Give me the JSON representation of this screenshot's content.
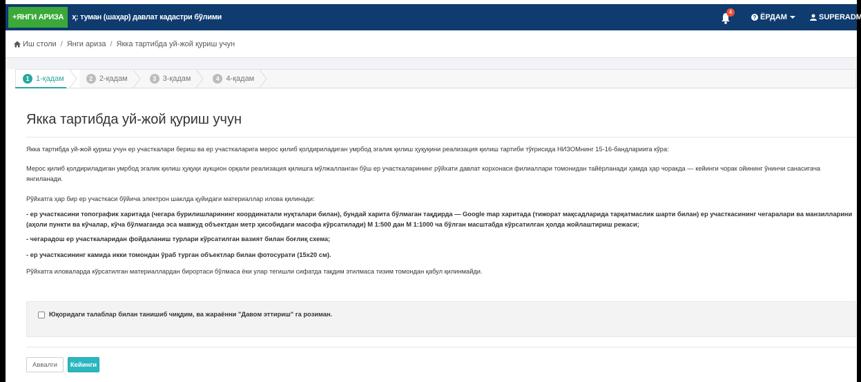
{
  "topbar": {
    "new_application_label": "+ЯНГИ АРИЗА",
    "org_title": "ҳ: туман (шаҳар) давлат кадастри бўлими",
    "notification_count": "4",
    "help_label": "ЁРДАМ",
    "user_label": "SUPERADMIN"
  },
  "breadcrumb": {
    "items": [
      "Иш столи",
      "Янги ариза",
      "Якка тартибда уй-жой қуриш учун"
    ]
  },
  "steps": [
    {
      "num": "1",
      "label": "1-қадам"
    },
    {
      "num": "2",
      "label": "2-қадам"
    },
    {
      "num": "3",
      "label": "3-қадам"
    },
    {
      "num": "4",
      "label": "4-қадам"
    }
  ],
  "page_title": "Якка тартибда уй-жой қуриш учун",
  "paragraphs": {
    "p1": "Якка тартибда уй-жой қуриш учун ер участкалари бериш ва ер участкаларига мерос қилиб қолдириладиган умрбод эгалик қилиш ҳуқуқини реализация қилиш тартиби тўғрисида НИЗОМнинг 15-16-бандлариига кўра:",
    "p2": "Мерос қилиб қолдириладиган умрбод эгалик қилиш ҳуқуқи аукцион орқали реализация қилишга мўлжалланган бўш ер участкаларининг рўйхати давлат корхонаси филиаллари томонидан тайёрланади ҳамда ҳар чоракда — кейинги чорак ойининг ўнинчи санасигача янгиланади.",
    "p3": "Рўйхатга ҳар бир ер участкаси бўйича электрон шаклда қуйидаги материаллар илова қилинади:",
    "p4": "- ер участкасини топографик харитада (чегара бурилишларининг координатали нуқталари билан), бундай харита бўлмаган тақдирда — Google map харитада (тижорат мақсадларида тарқатмаслик шарти билан) ер участкасининг чегаралари ва манзилларини (аҳоли пункти ва кўчалар, кўча бўлмаганда эса мавжуд объектдан метр ҳисобидаги масофа кўрсатилади) М 1:500 дан М 1:1000 ча бўлган масштабда кўрсатилган ҳолда жойлаштириш режаси;",
    "p5": "- чегарадош ер участкаларидан фойдаланиш турлари кўрсатилган вазият билан боғлиқ схема;",
    "p6": "- ер участкасининг камида икки томондан ўраб турган объектлар билан фотосурати (15х20 см).",
    "p7": "Рўйхатга иловаларда кўрсатилган материаллардан бирортаси бўлмаса ёки улар тегишли сифатда тақдим этилмаса тизим томондан қабул қилинмайди."
  },
  "agreement": {
    "label": "Юқоридаги талаблар билан танишиб чиқдим, ва жараённи \"Давом эттириш\" га розиман.",
    "checked": false
  },
  "buttons": {
    "prev_label": "Аввалги",
    "next_label": "Кейинги"
  },
  "colors": {
    "topbar": "#0f3b6e",
    "new_button": "#3aa93a",
    "accent": "#2aa7a0",
    "next_button": "#2ab7c0",
    "badge": "#e8503a"
  }
}
